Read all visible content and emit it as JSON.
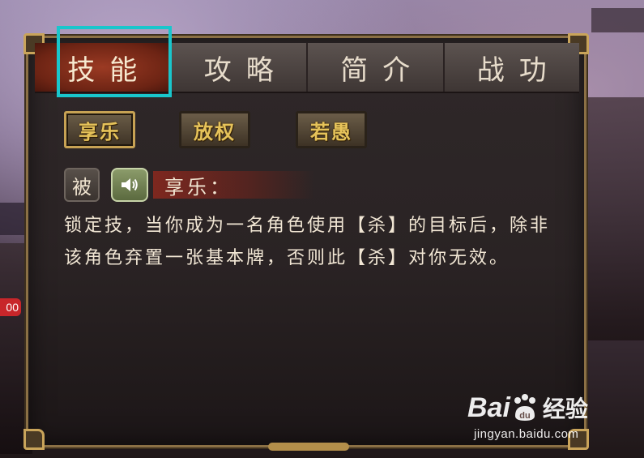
{
  "tabs": [
    {
      "label": "技能",
      "active": true
    },
    {
      "label": "攻略",
      "active": false
    },
    {
      "label": "简介",
      "active": false
    },
    {
      "label": "战功",
      "active": false
    }
  ],
  "skills": [
    {
      "label": "享乐",
      "selected": true
    },
    {
      "label": "放权",
      "selected": false
    },
    {
      "label": "若愚",
      "selected": false
    }
  ],
  "skill_detail": {
    "type_badge": "被",
    "name": "享乐：",
    "description": "锁定技，当你成为一名角色使用【杀】的目标后，除非该角色弃置一张基本牌，否则此【杀】对你无效。"
  },
  "side_badge": "00",
  "watermark": {
    "brand_a": "Bai",
    "brand_paw": "du",
    "brand_cn": "经验",
    "url": "jingyan.baidu.com"
  },
  "colors": {
    "highlight": "#19c6cc",
    "active_tab": "#8a2f1b",
    "skill_text": "#e6c35a"
  }
}
